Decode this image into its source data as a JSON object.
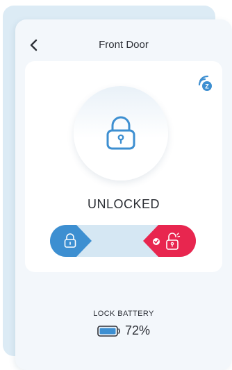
{
  "header": {
    "title": "Front Door",
    "back_icon": "chevron-left-icon"
  },
  "lock": {
    "status": "UNLOCKED",
    "icon": "padlock-icon",
    "network_icon": "z-wave-icon"
  },
  "slider": {
    "lock_icon": "locked-padlock-icon",
    "unlock_icon": "unlocked-padlock-icon",
    "selected": "unlock"
  },
  "battery": {
    "label": "LOCK BATTERY",
    "percent_text": "72%",
    "level": 0.72
  },
  "colors": {
    "accent_blue": "#3d8fd1",
    "unlock_red": "#e8264f",
    "card_back": "#dcebf5",
    "card_front": "#f3f7fb",
    "slider_track": "#d5e7f3"
  }
}
